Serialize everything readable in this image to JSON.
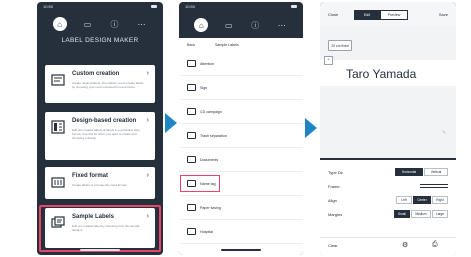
{
  "phone1": {
    "status_time": "10:50",
    "tabs": [
      {
        "icon": "home-icon",
        "active": true
      },
      {
        "icon": "folder-icon"
      },
      {
        "icon": "info-icon"
      },
      {
        "icon": "more-icon"
      }
    ],
    "title": "LABEL DESIGN MAKER",
    "menu": [
      {
        "title": "Custom creation",
        "desc": "Create original labels. Also allows you to create labels by choosing your recommended font and frame.",
        "icon": "custom-creation-icon"
      },
      {
        "title": "Design-based creation",
        "desc": "Edit pre-created labels of labels in a particular style format. Use this for when you want to create and choosing a design.",
        "icon": "design-based-icon"
      },
      {
        "title": "Fixed format",
        "desc": "Create labels of a frequently used format.",
        "icon": "fixed-format-icon"
      },
      {
        "title": "Sample Labels",
        "desc": "Edit pre-created label by choosing from the sample designs.",
        "icon": "sample-labels-icon"
      }
    ]
  },
  "phone2": {
    "status_time": "10:50",
    "header": {
      "close": "Back",
      "title": "Sample Labels"
    },
    "folders": [
      "Attention",
      "Sign",
      "CD campaign",
      "Trash separation",
      "Documents",
      "Name tag",
      "Paper saving",
      "Hospital"
    ],
    "highlighted": "Name tag"
  },
  "phone3": {
    "top": {
      "close": "Close",
      "tab_edit": "Edit",
      "tab_preview": "Preview",
      "save": "Save"
    },
    "fixed_label": "20 cm fixed",
    "label_text": "Taro Yamada",
    "rows": {
      "type_dir": {
        "label": "Type Dir.",
        "options": [
          "Horizontal",
          "Vertical"
        ],
        "selected": "Horizontal"
      },
      "frame": {
        "label": "Frame"
      },
      "align": {
        "label": "Align",
        "options": [
          "Left",
          "Center",
          "Right"
        ],
        "selected": "Center"
      },
      "margins": {
        "label": "Margins",
        "options": [
          "Small",
          "Medium",
          "Large"
        ],
        "selected": "Small"
      }
    },
    "bottom": {
      "clear": "Clear"
    }
  },
  "colors": {
    "dark": "#26303d",
    "accent": "#1f86c6",
    "highlight": "#e8456a"
  }
}
